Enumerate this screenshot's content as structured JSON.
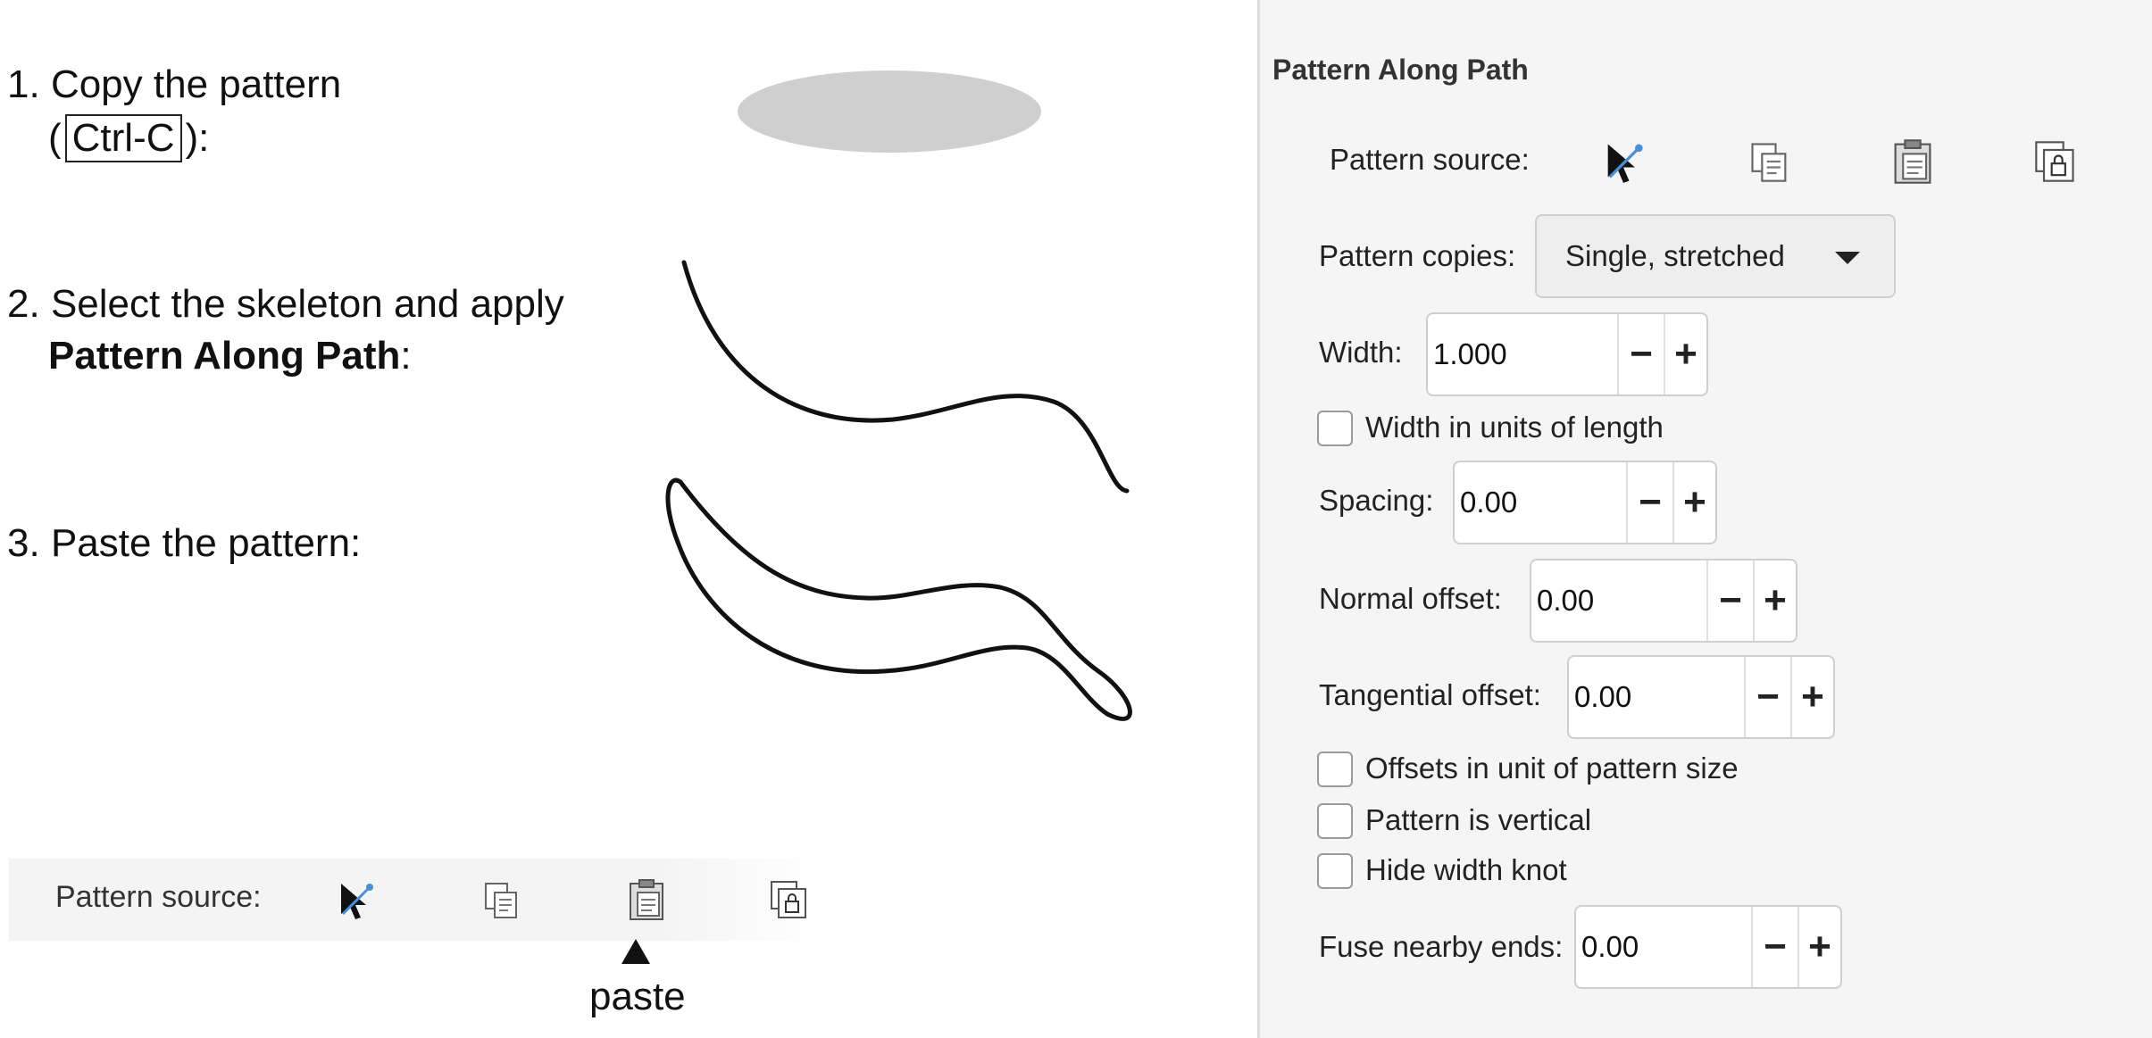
{
  "steps": {
    "step1": {
      "number": "1.",
      "text": "Copy the pattern",
      "paren_open": "(",
      "shortcut": "Ctrl-C",
      "paren_close": "):"
    },
    "step2": {
      "number": "2.",
      "text": "Select the skeleton and apply",
      "bold": "Pattern Along Path",
      "colon": ":"
    },
    "step3": {
      "number": "3.",
      "text": "Paste the pattern:"
    }
  },
  "strip": {
    "label": "Pattern source:",
    "icons": [
      "edit-on-canvas-icon",
      "copy-icon",
      "paste-icon",
      "link-to-clipboard-icon"
    ],
    "annotation": "paste"
  },
  "dialog": {
    "title": "Pattern Along Path",
    "pattern_source_label": "Pattern source:",
    "pattern_copies_label": "Pattern copies:",
    "pattern_copies_value": "Single, stretched",
    "width_label": "Width:",
    "width_value": "1.000",
    "width_units_label": "Width in units of length",
    "spacing_label": "Spacing:",
    "spacing_value": "0.00",
    "normal_offset_label": "Normal offset:",
    "normal_offset_value": "0.00",
    "tangential_offset_label": "Tangential offset:",
    "tangential_offset_value": "0.00",
    "offsets_unit_label": "Offsets in unit of pattern size",
    "vertical_label": "Pattern is vertical",
    "hide_knot_label": "Hide width knot",
    "fuse_label": "Fuse nearby ends:",
    "fuse_value": "0.00",
    "minus": "−",
    "plus": "+"
  },
  "colors": {
    "ellipse_fill": "#cfcfcf",
    "panel_bg": "#f5f5f5",
    "icon_accent": "#4a90d9"
  }
}
